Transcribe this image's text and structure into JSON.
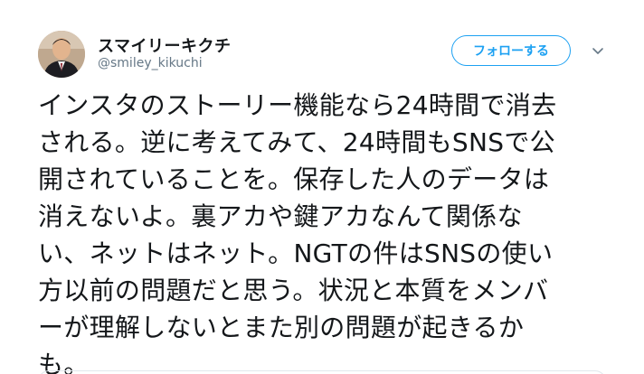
{
  "user": {
    "display_name": "スマイリーキクチ",
    "handle": "@smiley_kikuchi",
    "avatar_icon": "profile-photo"
  },
  "actions": {
    "follow_label": "フォローする",
    "menu_icon": "chevron-down-icon"
  },
  "tweet": {
    "lines": [
      "インスタのストーリー機能なら24時間で消去",
      "される。逆に考えてみて、24時間もSNSで公",
      "開されていることを。保存した人のデータは",
      "消えないよ。裏アカや鍵アカなんて関係な",
      "い、ネットはネット。NGTの件はSNSの使い",
      "方以前の問題だと思う。状況と本質をメンバ",
      "ーが理解しないとまた別の問題が起きるか",
      "も。"
    ]
  },
  "colors": {
    "accent": "#1da1f2",
    "text": "#14171a",
    "secondary": "#657786",
    "border": "#e1e8ed"
  }
}
